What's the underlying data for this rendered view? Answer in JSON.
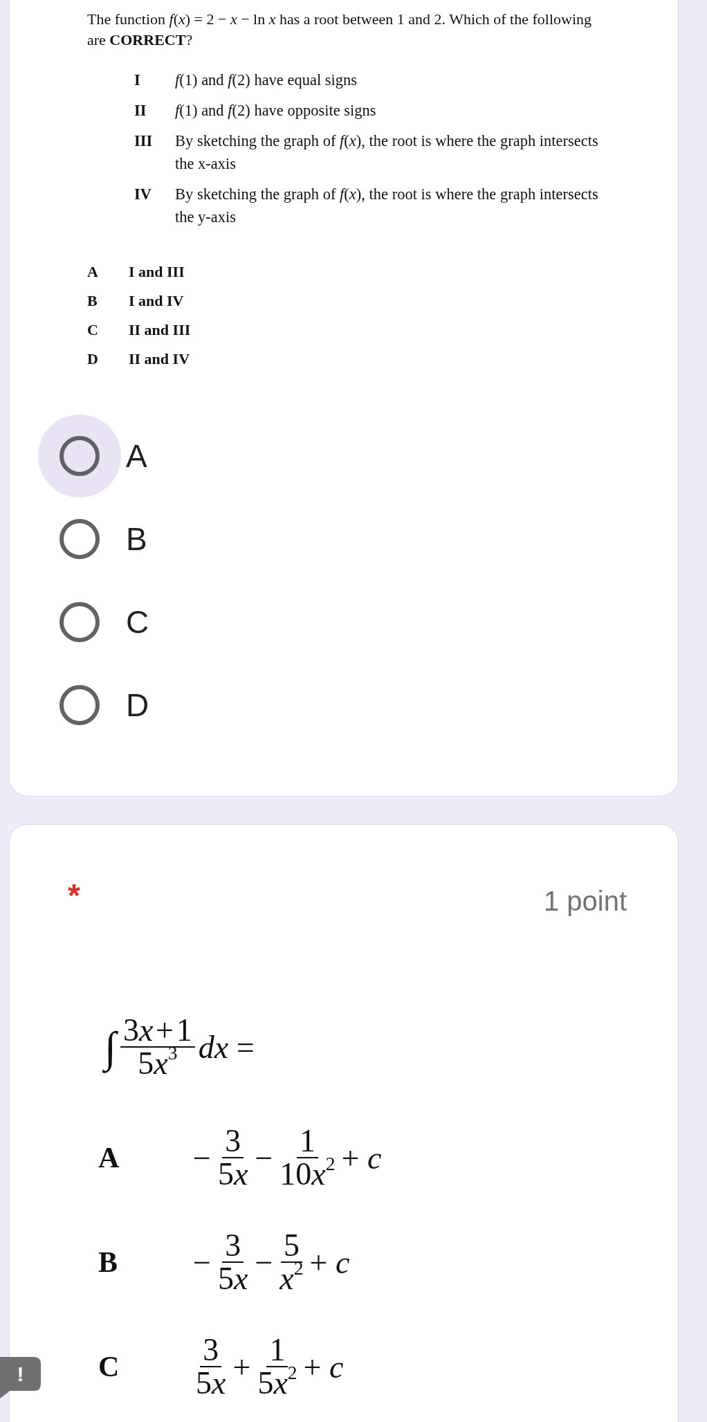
{
  "cards": [
    {
      "question_image": {
        "stem": "The function *f*(*x*) = 2 − *x* − ln *x* has a root between 1 and 2. Which of the following are **CORRECT**?",
        "statements": [
          {
            "numeral": "I",
            "text": "*f*(1) and *f*(2) have equal signs"
          },
          {
            "numeral": "II",
            "text": "*f*(1) and *f*(2) have opposite signs"
          },
          {
            "numeral": "III",
            "text": "By sketching the graph of *f*(*x*), the root is where the graph intersects the x-axis"
          },
          {
            "numeral": "IV",
            "text": "By sketching the graph of *f*(*x*), the root is where the graph intersects the y-axis"
          }
        ],
        "choices": [
          {
            "letter": "A",
            "text": "I and III"
          },
          {
            "letter": "B",
            "text": "I and IV"
          },
          {
            "letter": "C",
            "text": "II and III"
          },
          {
            "letter": "D",
            "text": "II and IV"
          }
        ]
      },
      "options": [
        {
          "label": "A",
          "selected": false,
          "focused": true
        },
        {
          "label": "B",
          "selected": false,
          "focused": false
        },
        {
          "label": "C",
          "selected": false,
          "focused": false
        },
        {
          "label": "D",
          "selected": false,
          "focused": false
        }
      ]
    },
    {
      "required_marker": "*",
      "points": "1 point",
      "question_image": {
        "integral": {
          "symbol": "∫",
          "numerator": [
            {
              "kind": "number",
              "text": "3"
            },
            {
              "kind": "variable",
              "text": "x"
            },
            {
              "kind": "operator",
              "text": "+"
            },
            {
              "kind": "number",
              "text": "1"
            }
          ],
          "denominator": [
            {
              "kind": "number",
              "text": "5"
            },
            {
              "kind": "variable",
              "text": "x"
            },
            {
              "kind": "power",
              "text": "3"
            }
          ],
          "tail": "*dx* ="
        }
      },
      "answer_image": {
        "choices": [
          {
            "letter": "A",
            "terms": [
              {
                "sign": "−",
                "numerator": [
                  {
                    "kind": "number",
                    "text": "3"
                  }
                ],
                "denominator": [
                  {
                    "kind": "number",
                    "text": "5"
                  },
                  {
                    "kind": "variable",
                    "text": "x"
                  }
                ]
              },
              {
                "sign": "−",
                "numerator": [
                  {
                    "kind": "number",
                    "text": "1"
                  }
                ],
                "denominator": [
                  {
                    "kind": "number",
                    "text": "10"
                  },
                  {
                    "kind": "variable",
                    "text": "x"
                  },
                  {
                    "kind": "power",
                    "text": "2"
                  }
                ]
              }
            ],
            "tail": "+ *c*"
          },
          {
            "letter": "B",
            "terms": [
              {
                "sign": "−",
                "numerator": [
                  {
                    "kind": "number",
                    "text": "3"
                  }
                ],
                "denominator": [
                  {
                    "kind": "number",
                    "text": "5"
                  },
                  {
                    "kind": "variable",
                    "text": "x"
                  }
                ]
              },
              {
                "sign": "−",
                "numerator": [
                  {
                    "kind": "number",
                    "text": "5"
                  }
                ],
                "denominator": [
                  {
                    "kind": "variable",
                    "text": "x"
                  },
                  {
                    "kind": "power",
                    "text": "2"
                  }
                ]
              }
            ],
            "tail": "+ *c*"
          },
          {
            "letter": "C",
            "terms": [
              {
                "numerator": [
                  {
                    "kind": "number",
                    "text": "3"
                  }
                ],
                "denominator": [
                  {
                    "kind": "number",
                    "text": "5"
                  },
                  {
                    "kind": "variable",
                    "text": "x"
                  }
                ]
              },
              {
                "sign": "+",
                "numerator": [
                  {
                    "kind": "number",
                    "text": "1"
                  }
                ],
                "denominator": [
                  {
                    "kind": "number",
                    "text": "5"
                  },
                  {
                    "kind": "variable",
                    "text": "x"
                  },
                  {
                    "kind": "power",
                    "text": "2"
                  }
                ]
              }
            ],
            "tail": "+ *c*"
          }
        ]
      }
    }
  ],
  "feedback_button": "!"
}
